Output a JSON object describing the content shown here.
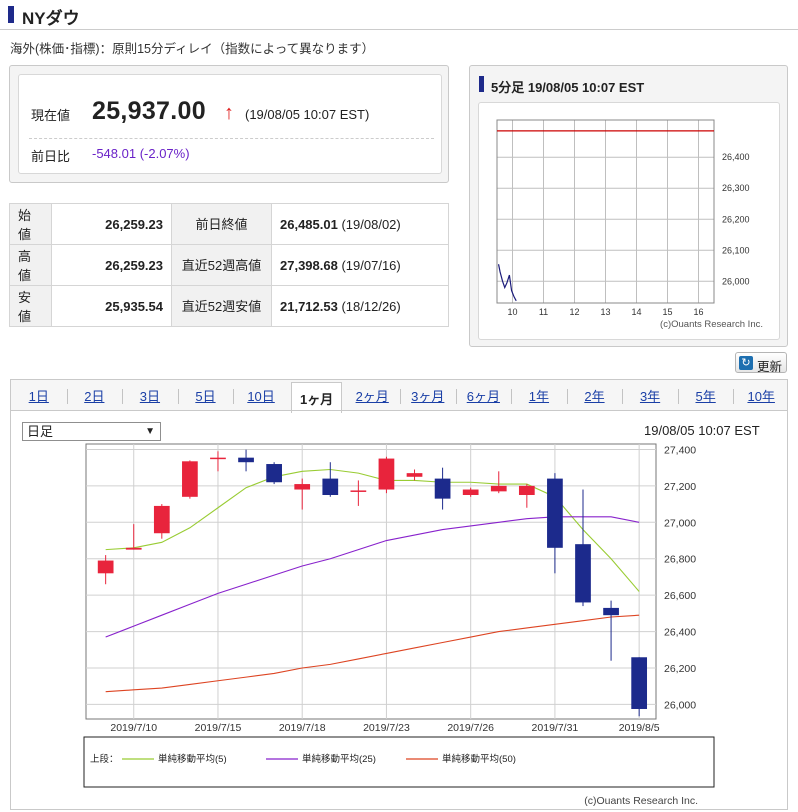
{
  "header": {
    "title": "NYダウ"
  },
  "note": "海外(株価･指標)：原則15分ディレイ（指数によって異なります）",
  "quote": {
    "current_label": "現在値",
    "current_value": "25,937.00",
    "arrow": "↑",
    "current_time": "(19/08/05 10:07 EST)",
    "change_label": "前日比",
    "change_value": "-548.01 (-2.07%)"
  },
  "table": {
    "rows": [
      {
        "l1": "始値",
        "v1": "26,259.23",
        "l2": "前日終値",
        "v2": "26,485.01",
        "d2": "(19/08/02)"
      },
      {
        "l1": "高値",
        "v1": "26,259.23",
        "l2": "直近52週高値",
        "v2": "27,398.68",
        "d2": "(19/07/16)"
      },
      {
        "l1": "安値",
        "v1": "25,935.54",
        "l2": "直近52週安値",
        "v2": "21,712.53",
        "d2": "(18/12/26)"
      }
    ]
  },
  "intraday": {
    "title": "5分足 19/08/05 10:07 EST",
    "credit": "(c)Ouants Research Inc.",
    "colors": {
      "line": "#1a1a7a",
      "ref": "#cc0000"
    }
  },
  "refresh_label": "更新",
  "tabs": [
    {
      "label": "1日",
      "active": false
    },
    {
      "label": "2日",
      "active": false
    },
    {
      "label": "3日",
      "active": false
    },
    {
      "label": "5日",
      "active": false
    },
    {
      "label": "10日",
      "active": false
    },
    {
      "label": "1ヶ月",
      "active": true
    },
    {
      "label": "2ヶ月",
      "active": false
    },
    {
      "label": "3ヶ月",
      "active": false
    },
    {
      "label": "6ヶ月",
      "active": false
    },
    {
      "label": "1年",
      "active": false
    },
    {
      "label": "2年",
      "active": false
    },
    {
      "label": "3年",
      "active": false
    },
    {
      "label": "5年",
      "active": false
    },
    {
      "label": "10年",
      "active": false
    }
  ],
  "select": {
    "value": "日足"
  },
  "timestamp": "19/08/05 10:07 EST",
  "credit": "(c)Ouants Research Inc.",
  "chart_data": [
    {
      "type": "line",
      "title": "5分足 19/08/05 10:07 EST",
      "x_ticks": [
        "10",
        "11",
        "12",
        "13",
        "14",
        "15",
        "16"
      ],
      "y_ticks": [
        "26,000",
        "26,100",
        "26,200",
        "26,300",
        "26,400"
      ],
      "ylim": [
        25930,
        26520
      ],
      "reference_line": 26485.01,
      "series": [
        {
          "x": [
            9.55,
            9.6,
            9.68,
            9.75,
            9.82,
            9.9,
            9.97,
            10.05,
            10.12
          ],
          "values": [
            26055,
            26030,
            26000,
            25980,
            25995,
            26020,
            25970,
            25950,
            25937
          ]
        }
      ]
    },
    {
      "type": "candlestick",
      "x_labels": [
        "2019/7/10",
        "2019/7/15",
        "2019/7/18",
        "2019/7/23",
        "2019/7/26",
        "2019/7/31",
        "2019/8/5"
      ],
      "y_ticks": [
        "26,000",
        "26,200",
        "26,400",
        "26,600",
        "26,800",
        "27,000",
        "27,200",
        "27,400"
      ],
      "ylim": [
        25920,
        27430
      ],
      "grid": true,
      "legend_title": "上段：",
      "candles": [
        {
          "open": 26720,
          "close": 26790,
          "high": 26820,
          "low": 26660
        },
        {
          "open": 26850,
          "close": 26860,
          "high": 26990,
          "low": 26850
        },
        {
          "open": 26940,
          "close": 27090,
          "high": 27100,
          "low": 26910
        },
        {
          "open": 27140,
          "close": 27335,
          "high": 27340,
          "low": 27130
        },
        {
          "open": 27355,
          "close": 27355,
          "high": 27390,
          "low": 27280
        },
        {
          "open": 27355,
          "close": 27330,
          "high": 27399,
          "low": 27280
        },
        {
          "open": 27320,
          "close": 27220,
          "high": 27330,
          "low": 27210
        },
        {
          "open": 27180,
          "close": 27210,
          "high": 27240,
          "low": 27070
        },
        {
          "open": 27240,
          "close": 27150,
          "high": 27330,
          "low": 27140
        },
        {
          "open": 27170,
          "close": 27175,
          "high": 27230,
          "low": 27090
        },
        {
          "open": 27180,
          "close": 27350,
          "high": 27360,
          "low": 27160
        },
        {
          "open": 27250,
          "close": 27270,
          "high": 27290,
          "low": 27230
        },
        {
          "open": 27240,
          "close": 27130,
          "high": 27300,
          "low": 27070
        },
        {
          "open": 27150,
          "close": 27180,
          "high": 27190,
          "low": 27140
        },
        {
          "open": 27170,
          "close": 27200,
          "high": 27280,
          "low": 27160
        },
        {
          "open": 27150,
          "close": 27200,
          "high": 27210,
          "low": 27080
        },
        {
          "open": 27240,
          "close": 26860,
          "high": 27270,
          "low": 26720
        },
        {
          "open": 26880,
          "close": 26560,
          "high": 27180,
          "low": 26540
        },
        {
          "open": 26530,
          "close": 26490,
          "high": 26570,
          "low": 26240
        },
        {
          "open": 26259,
          "close": 25975,
          "high": 26259,
          "low": 25935
        }
      ],
      "series": [
        {
          "name": "単純移動平均(5)",
          "color": "#99cc33",
          "values": [
            26850,
            26860,
            26890,
            26970,
            27080,
            27190,
            27250,
            27280,
            27290,
            27270,
            27230,
            27230,
            27220,
            27220,
            27210,
            27210,
            27140,
            26960,
            26800,
            26620
          ]
        },
        {
          "name": "単純移動平均(25)",
          "color": "#8822cc",
          "values": [
            26370,
            26430,
            26490,
            26550,
            26610,
            26660,
            26710,
            26760,
            26800,
            26850,
            26900,
            26930,
            26960,
            26980,
            27000,
            27020,
            27030,
            27030,
            27030,
            27000
          ]
        },
        {
          "name": "単純移動平均(50)",
          "color": "#dd4422",
          "values": [
            26070,
            26080,
            26090,
            26110,
            26130,
            26150,
            26170,
            26200,
            26220,
            26250,
            26280,
            26310,
            26340,
            26370,
            26400,
            26420,
            26440,
            26460,
            26480,
            26490
          ]
        }
      ],
      "up_color": "#e8243c",
      "down_color": "#1c2a8c"
    }
  ]
}
